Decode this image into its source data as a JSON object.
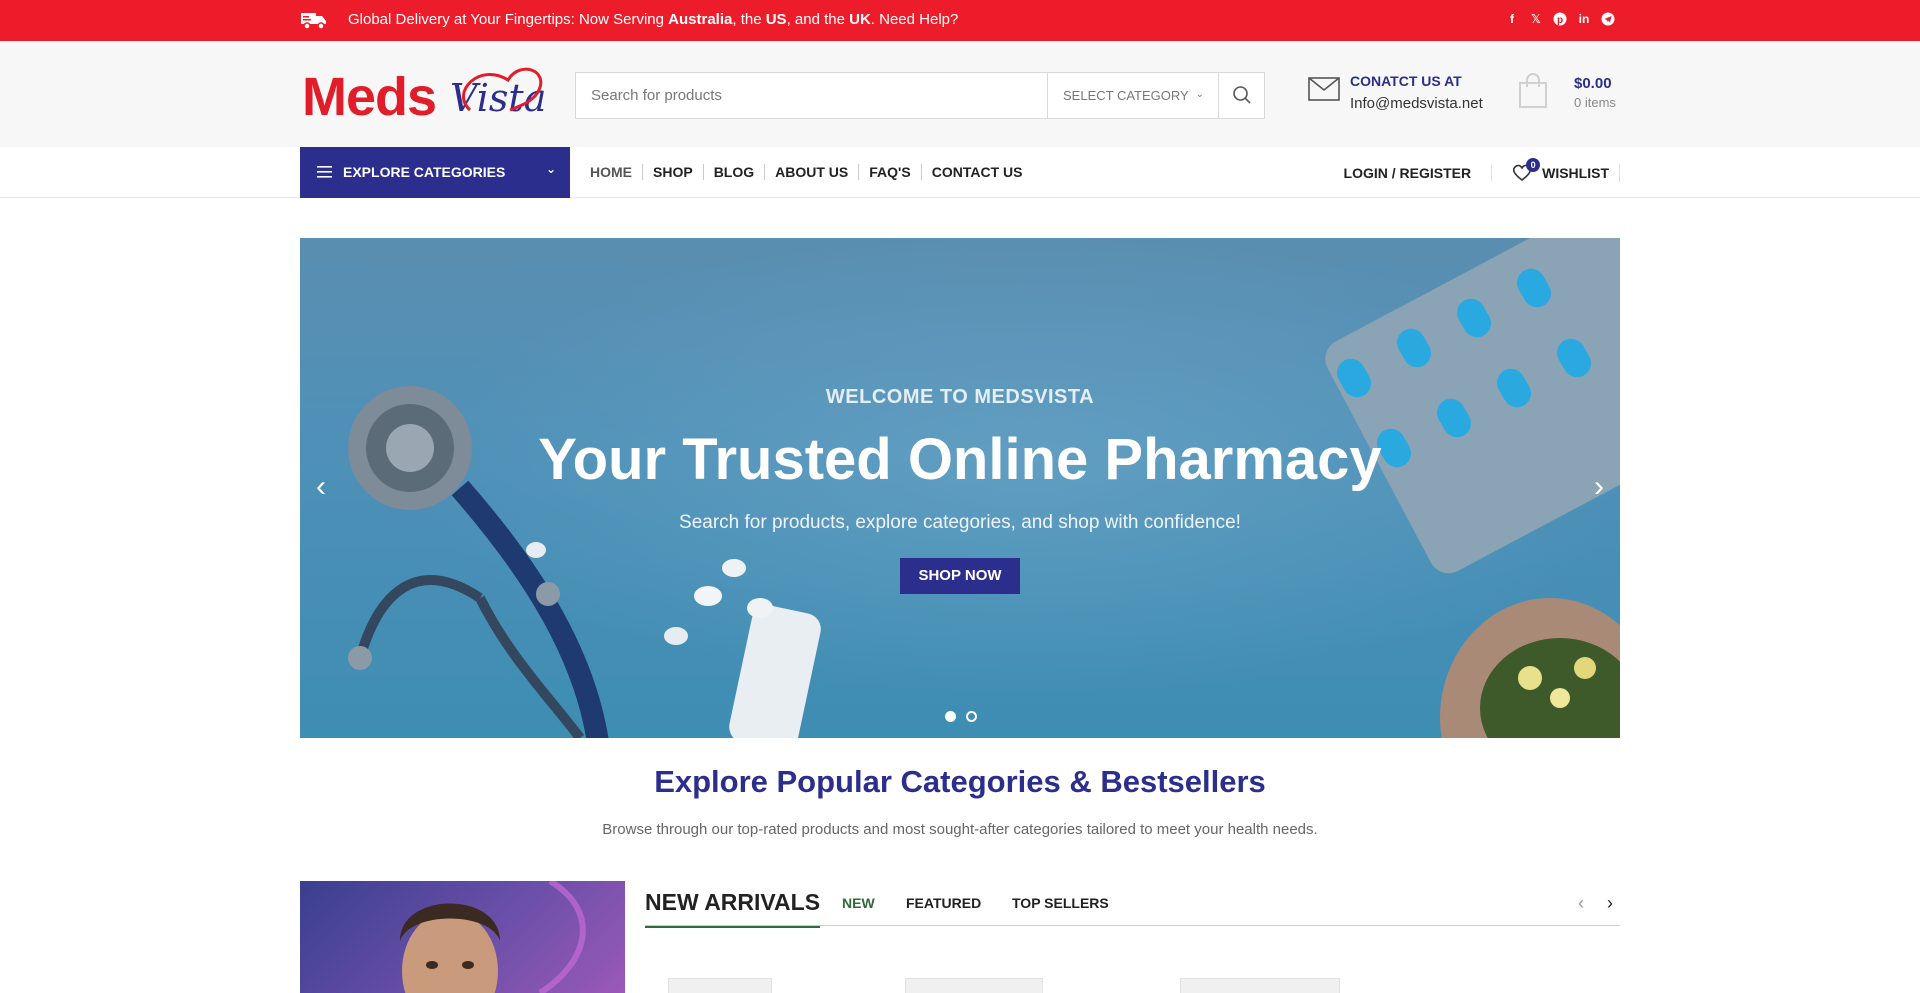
{
  "topbar": {
    "message_prefix": "Global Delivery at Your Fingertips: Now Serving ",
    "country1": "Australia",
    "sep1": ", the ",
    "country2": "US",
    "sep2": ", and the ",
    "country3": "UK",
    "message_suffix": ". Need Help?",
    "social_icons": [
      "facebook-icon",
      "x-icon",
      "pinterest-icon",
      "linkedin-icon",
      "telegram-icon"
    ],
    "background": "#ed1c2a"
  },
  "header": {
    "logo_text_1": "Meds",
    "logo_text_2": "Vista",
    "search": {
      "placeholder": "Search for products",
      "category_label": "SELECT CATEGORY"
    },
    "contact": {
      "label": "CONATCT US AT",
      "email": "Info@medsvista.net"
    },
    "cart": {
      "amount": "$0.00",
      "items": "0 items"
    }
  },
  "nav": {
    "explore_label": "EXPLORE CATEGORIES",
    "items": [
      "HOME",
      "SHOP",
      "BLOG",
      "ABOUT US",
      "FAQ'S",
      "CONTACT US"
    ],
    "login": "LOGIN / REGISTER",
    "wishlist": "WISHLIST",
    "wishlist_count": "0"
  },
  "hero": {
    "welcome": "WELCOME TO MEDSVISTA",
    "title": "Your Trusted Online Pharmacy",
    "subtitle": "Search for products, explore categories, and shop with confidence!",
    "cta": "SHOP NOW",
    "slides": 2,
    "active_slide": 1
  },
  "section": {
    "title": "Explore Popular Categories & Bestsellers",
    "subtitle": "Browse through our top-rated products and most sought-after categories tailored to meet your health needs."
  },
  "products": {
    "heading": "NEW ARRIVALS",
    "tabs": [
      "NEW",
      "FEATURED",
      "TOP SELLERS"
    ],
    "active_tab": "NEW"
  },
  "colors": {
    "brand_red": "#ed1c2a",
    "brand_blue": "#2c2e8d",
    "tab_green": "#2d6b3a"
  }
}
